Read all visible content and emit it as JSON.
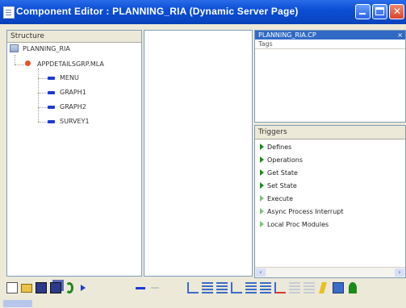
{
  "window": {
    "title": "Component Editor : PLANNING_RIA (Dynamic Server Page)",
    "icon": "document-icon"
  },
  "structure": {
    "header": "Structure",
    "root": "PLANNING_RIA",
    "child": "APPDETAILSGRP.MLA",
    "leaves": [
      "MENU",
      "GRAPH1",
      "GRAPH2",
      "SURVEY1"
    ]
  },
  "props": {
    "selected_tab": "PLANNING_RIA.CP",
    "sub_label": "Tags"
  },
  "triggers": {
    "header": "Triggers",
    "items": [
      {
        "label": "Defines",
        "filled": true
      },
      {
        "label": "Operations",
        "filled": true
      },
      {
        "label": "Get State",
        "filled": true
      },
      {
        "label": "Set State",
        "filled": true
      },
      {
        "label": "Execute",
        "filled": false
      },
      {
        "label": "Async Process Interrupt",
        "filled": false
      },
      {
        "label": "Local Proc Modules",
        "filled": false
      }
    ]
  },
  "colors": {
    "titlebar": "#0b4fd6",
    "leaf_icon": "#1a3bd6",
    "trigger_arrow": "#1a8a1a"
  }
}
